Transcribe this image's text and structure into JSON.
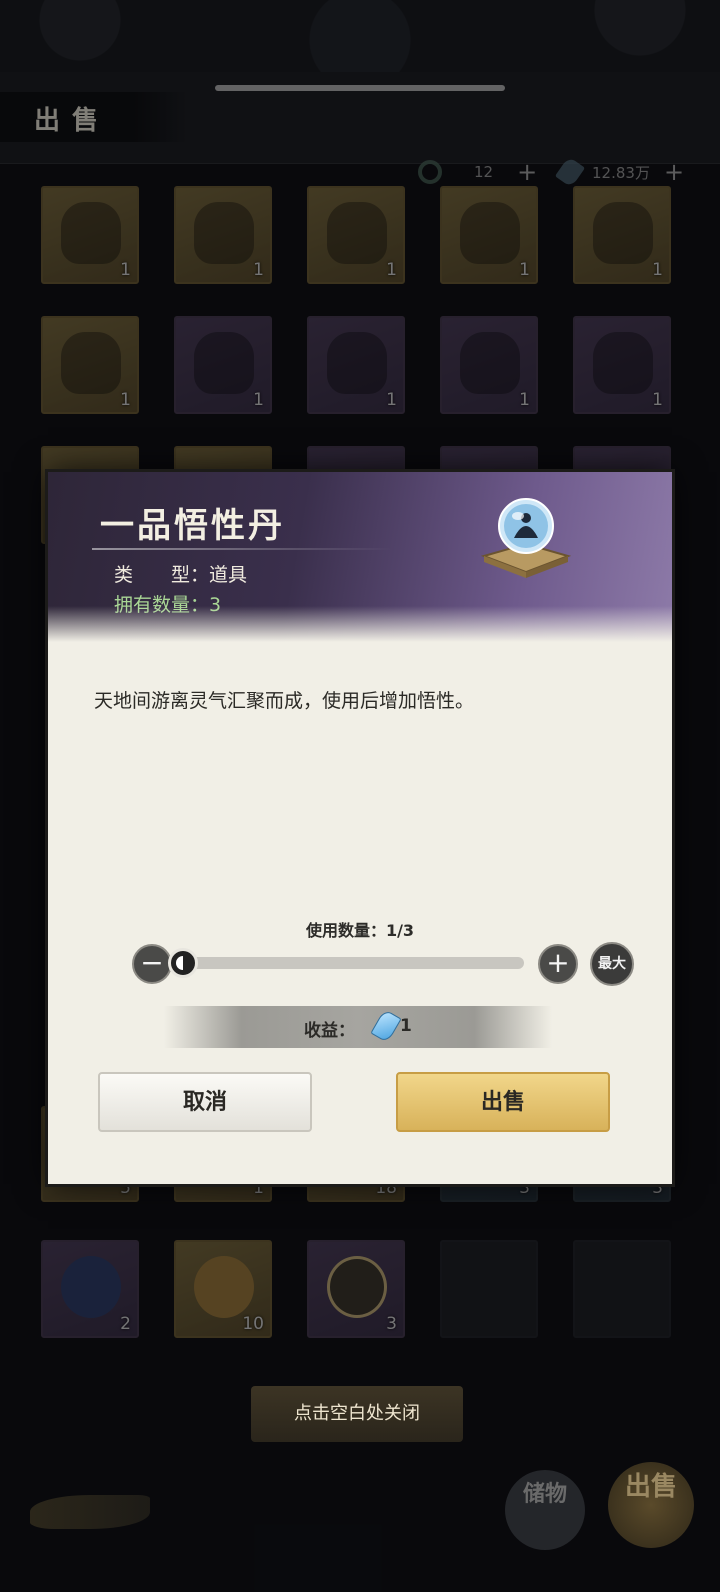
{
  "header": {
    "title": "出售",
    "currency_jade": {
      "value": "12",
      "plus": "+"
    },
    "currency_spirit": {
      "value": "12.83万",
      "plus": "+"
    }
  },
  "grid": {
    "row1": [
      {
        "qty": "1"
      },
      {
        "qty": "1"
      },
      {
        "qty": "1"
      },
      {
        "qty": "1"
      },
      {
        "qty": "1"
      }
    ],
    "row2": [
      {
        "qty": "1"
      },
      {
        "qty": "1"
      },
      {
        "qty": "1"
      },
      {
        "qty": "1"
      },
      {
        "qty": "1"
      }
    ],
    "row_hidden_bottom": [
      {
        "qty": "5"
      },
      {
        "qty": "1"
      },
      {
        "qty": "18"
      },
      {
        "qty": "3"
      },
      {
        "qty": "3"
      }
    ],
    "row_last": [
      {
        "qty": "2"
      },
      {
        "qty": "10"
      },
      {
        "qty": "3"
      }
    ]
  },
  "close_hint": "点击空白处关闭",
  "fab": {
    "store": "储物",
    "sell": "出售"
  },
  "modal": {
    "item_name": "一品悟性丹",
    "type_line": "类　　型：道具",
    "owned_line": "拥有数量：3",
    "description": "天地间游离灵气汇聚而成，使用后增加悟性。",
    "usage_label": "使用数量：1/3",
    "usage": {
      "current": 1,
      "max": 3
    },
    "minus": "−",
    "plus": "+",
    "max_label": "最大",
    "income_label": "收益：",
    "income_value": "1",
    "cancel_label": "取消",
    "sell_label": "出售"
  },
  "colors": {
    "owned_green": "#a9d695",
    "sell_gold": "#d8b25a",
    "modal_bg": "#f1efe6",
    "header_purple": "#3a2f4c"
  }
}
